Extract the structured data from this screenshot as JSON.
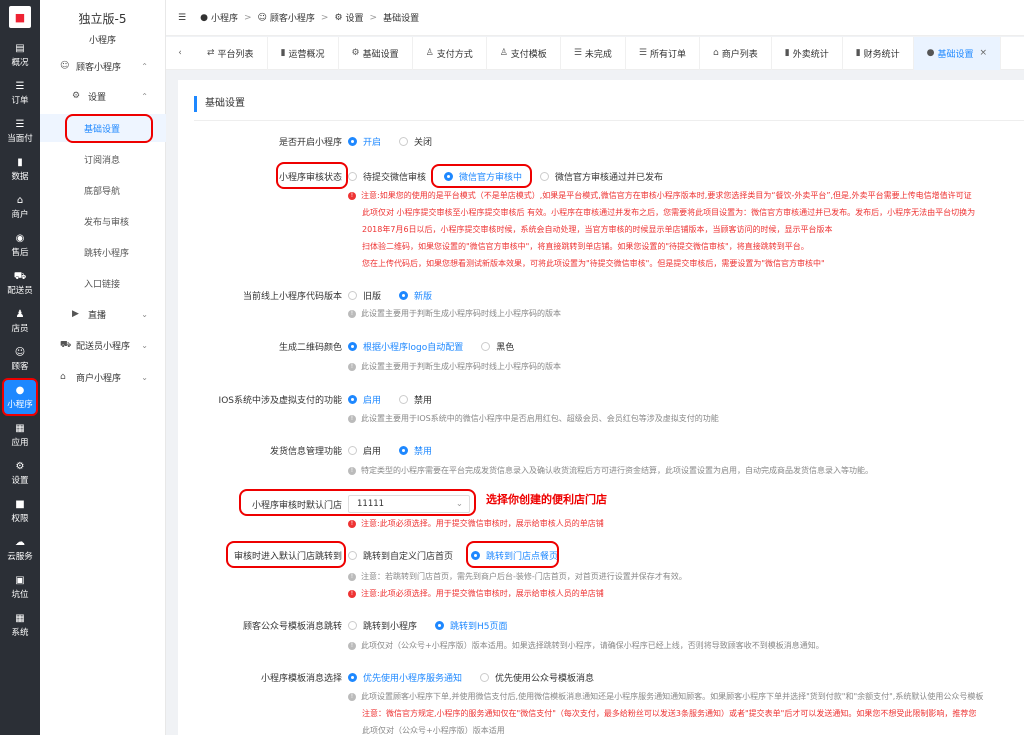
{
  "rail": {
    "items": [
      {
        "icon": "▤",
        "label": "概况"
      },
      {
        "icon": "☰",
        "label": "订单"
      },
      {
        "icon": "☰",
        "label": "当面付"
      },
      {
        "icon": "▮",
        "label": "数据"
      },
      {
        "icon": "⌂",
        "label": "商户"
      },
      {
        "icon": "◉",
        "label": "售后"
      },
      {
        "icon": "⛟",
        "label": "配送员"
      },
      {
        "icon": "♟",
        "label": "店员"
      },
      {
        "icon": "☺",
        "label": "顾客"
      },
      {
        "icon": "●",
        "label": "小程序"
      },
      {
        "icon": "▦",
        "label": "应用"
      },
      {
        "icon": "⚙",
        "label": "设置"
      },
      {
        "icon": "■",
        "label": "权限"
      },
      {
        "icon": "☁",
        "label": "云服务"
      },
      {
        "icon": "▣",
        "label": "坑位"
      },
      {
        "icon": "▦",
        "label": "系统"
      }
    ]
  },
  "sidebar": {
    "brand": "独立版-5",
    "subtitle": "小程序",
    "groups": {
      "customer": "顾客小程序",
      "settings": "设置",
      "live": "直播",
      "courier": "配送员小程序",
      "merchant": "商户小程序"
    },
    "items": [
      "基础设置",
      "订阅消息",
      "底部导航",
      "发布与审核",
      "跳转小程序",
      "入口链接"
    ]
  },
  "breadcrumb": {
    "items": [
      "小程序",
      "顾客小程序",
      "设置",
      "基础设置"
    ]
  },
  "tabs": [
    "平台列表",
    "运营概况",
    "基础设置",
    "支付方式",
    "支付模板",
    "未完成",
    "所有订单",
    "商户列表",
    "外卖统计",
    "财务统计",
    "基础设置"
  ],
  "section_title": "基础设置",
  "form": {
    "enable": {
      "label": "是否开启小程序",
      "options": [
        "开启",
        "关闭"
      ]
    },
    "review_status": {
      "label": "小程序审核状态",
      "options": [
        "待提交微信审核",
        "微信官方审核中",
        "微信官方审核通过并已发布"
      ],
      "notes": [
        "注意:如果您的使用的是平台模式（不是单店模式）,如果是平台模式,微信官方在审核小程序版本时,要求您选择类目为“餐饮-外卖平台”,但是,外卖平台需要上传电信增值许可证",
        "此项仅对 小程序提交审核至小程序提交审核后 有效。小程序在审核通过并发布之后，您需要将此项目设置为：微信官方审核通过并已发布。发布后，小程序无法由平台切换为",
        "2018年7月6日以后，小程序提交审核时候，系统会自动处理，当官方审核的时候显示单店铺版本，当顾客访问的时候，显示平台版本",
        "扫体验二维码，如果您设置的\"微信官方审核中\"，将直接跳转到单店铺。如果您设置的\"待提交微信审核\"，将直接跳转到平台。",
        "您在上传代码后，如果您想看测试新版本效果，可将此项设置为\"待提交微信审核\"。但是提交审核后，需要设置为\"微信官方审核中\""
      ]
    },
    "code_version": {
      "label": "当前线上小程序代码版本",
      "options": [
        "旧版",
        "新版"
      ],
      "note": "此设置主要用于判断生成小程序码时线上小程序码的版本"
    },
    "qr_color": {
      "label": "生成二维码颜色",
      "options": [
        "根据小程序logo自动配置",
        "黑色"
      ],
      "note": "此设置主要用于判断生成小程序码时线上小程序码的版本"
    },
    "ios_pay": {
      "label": "IOS系统中涉及虚拟支付的功能",
      "options": [
        "启用",
        "禁用"
      ],
      "note": "此设置主要用于IOS系统中的微信小程序中是否启用红包、超级会员、会员红包等涉及虚拟支付的功能"
    },
    "shipping": {
      "label": "发货信息管理功能",
      "options": [
        "启用",
        "禁用"
      ],
      "note": "特定类型的小程序需要在平台完成发货信息录入及确认收货流程后方可进行资金结算，此项设置设置为启用，自动完成商品发货信息录入等功能。"
    },
    "default_store": {
      "label": "小程序审核时默认门店",
      "value": "11111",
      "annotation": "选择你创建的便利店门店",
      "note": "注意:此项必须选择。用于提交微信审核时，展示给审核人员的单店铺"
    },
    "jump": {
      "label": "审核时进入默认门店跳转到",
      "options": [
        "跳转到自定义门店首页",
        "跳转到门店点餐页"
      ],
      "notes": [
        "注意：若跳转到门店首页，需先到商户后台-装修-门店首页，对首页进行设置并保存才有效。",
        "注意:此项必须选择。用于提交微信审核时，展示给审核人员的单店铺"
      ]
    },
    "template_jump": {
      "label": "顾客公众号模板消息跳转",
      "options": [
        "跳转到小程序",
        "跳转到H5页面"
      ],
      "note": "此项仅对（公众号+小程序版）版本适用。如果选择跳转到小程序，请确保小程序已经上线，否则将导致顾客收不到模板消息通知。"
    },
    "template_choice": {
      "label": "小程序模板消息选择",
      "options": [
        "优先使用小程序服务通知",
        "优先使用公众号模板消息"
      ],
      "notes": [
        "此项设置顾客小程序下单,并使用微信支付后,使用微信模板消息通知还是小程序服务通知通知顾客。如果顾客小程序下单并选择\"货到付款\"和\"余额支付\",系统默认使用公众号模板",
        "注意：微信官方规定,小程序的服务通知仅在\"微信支付\"（每次支付，最多给粉丝可以发送3条服务通知）或者\"提交表单\"后才可以发送通知。如果您不想受此限制影响，推荐您",
        "此项仅对（公众号+小程序版）版本适用"
      ]
    }
  }
}
